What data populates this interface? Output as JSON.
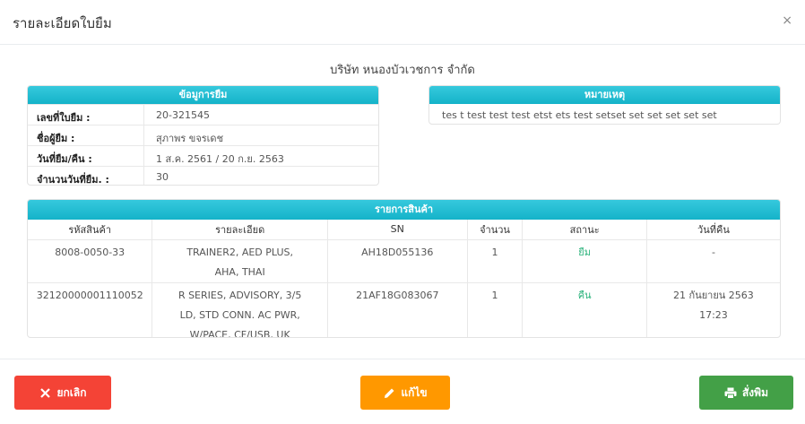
{
  "modal": {
    "title": "รายละเอียดใบยืม",
    "close": "×"
  },
  "company": "บริษัท หนองบัวเวชการ จำกัด",
  "loan_info": {
    "header": "ข้อมูการยืม",
    "rows": [
      {
        "label": "เลขที่ใบยืม :",
        "value": "20-321545"
      },
      {
        "label": "ชื่อผู้ยืม :",
        "value": "สุภาพร ขจรเดช"
      },
      {
        "label": "วันที่ยืม/คืน :",
        "value": "1 ส.ค. 2561 / 20 ก.ย. 2563"
      },
      {
        "label": "จำนวนวันที่ยืม. :",
        "value": "30"
      }
    ]
  },
  "remark": {
    "header": "หมายเหตุ",
    "text": "tes t test test test etst ets test setset set set set set set"
  },
  "items": {
    "header": "รายการสินค้า",
    "columns": [
      "รหัสสินค้า",
      "รายละเอียด",
      "SN",
      "จำนวน",
      "สถานะ",
      "วันที่คืน"
    ],
    "rows": [
      {
        "code": "8008-0050-33",
        "detail": "TRAINER2, AED PLUS, AHA, THAI",
        "sn": "AH18D055136",
        "qty": "1",
        "status": "ยืม",
        "return_date": "-"
      },
      {
        "code": "32120000001110052",
        "detail": "R SERIES, ADVISORY, 3/5 LD, STD CONN. AC PWR, W/PACE, CF/USB, UK",
        "sn": "21AF18G083067",
        "qty": "1",
        "status": "คืน",
        "return_date": "21 กันยายน 2563 17:23"
      }
    ]
  },
  "buttons": {
    "cancel": "ยกเลิก",
    "edit": "แก้ไข",
    "print": "สั่งพิม"
  },
  "colors": {
    "accent": "#1ebfd5",
    "cancel": "#f44336",
    "edit": "#ff9800",
    "print": "#43a047",
    "status": "#2ab27b"
  },
  "icons": {
    "cancel": "close-icon",
    "edit": "pencil-icon",
    "print": "printer-icon"
  }
}
